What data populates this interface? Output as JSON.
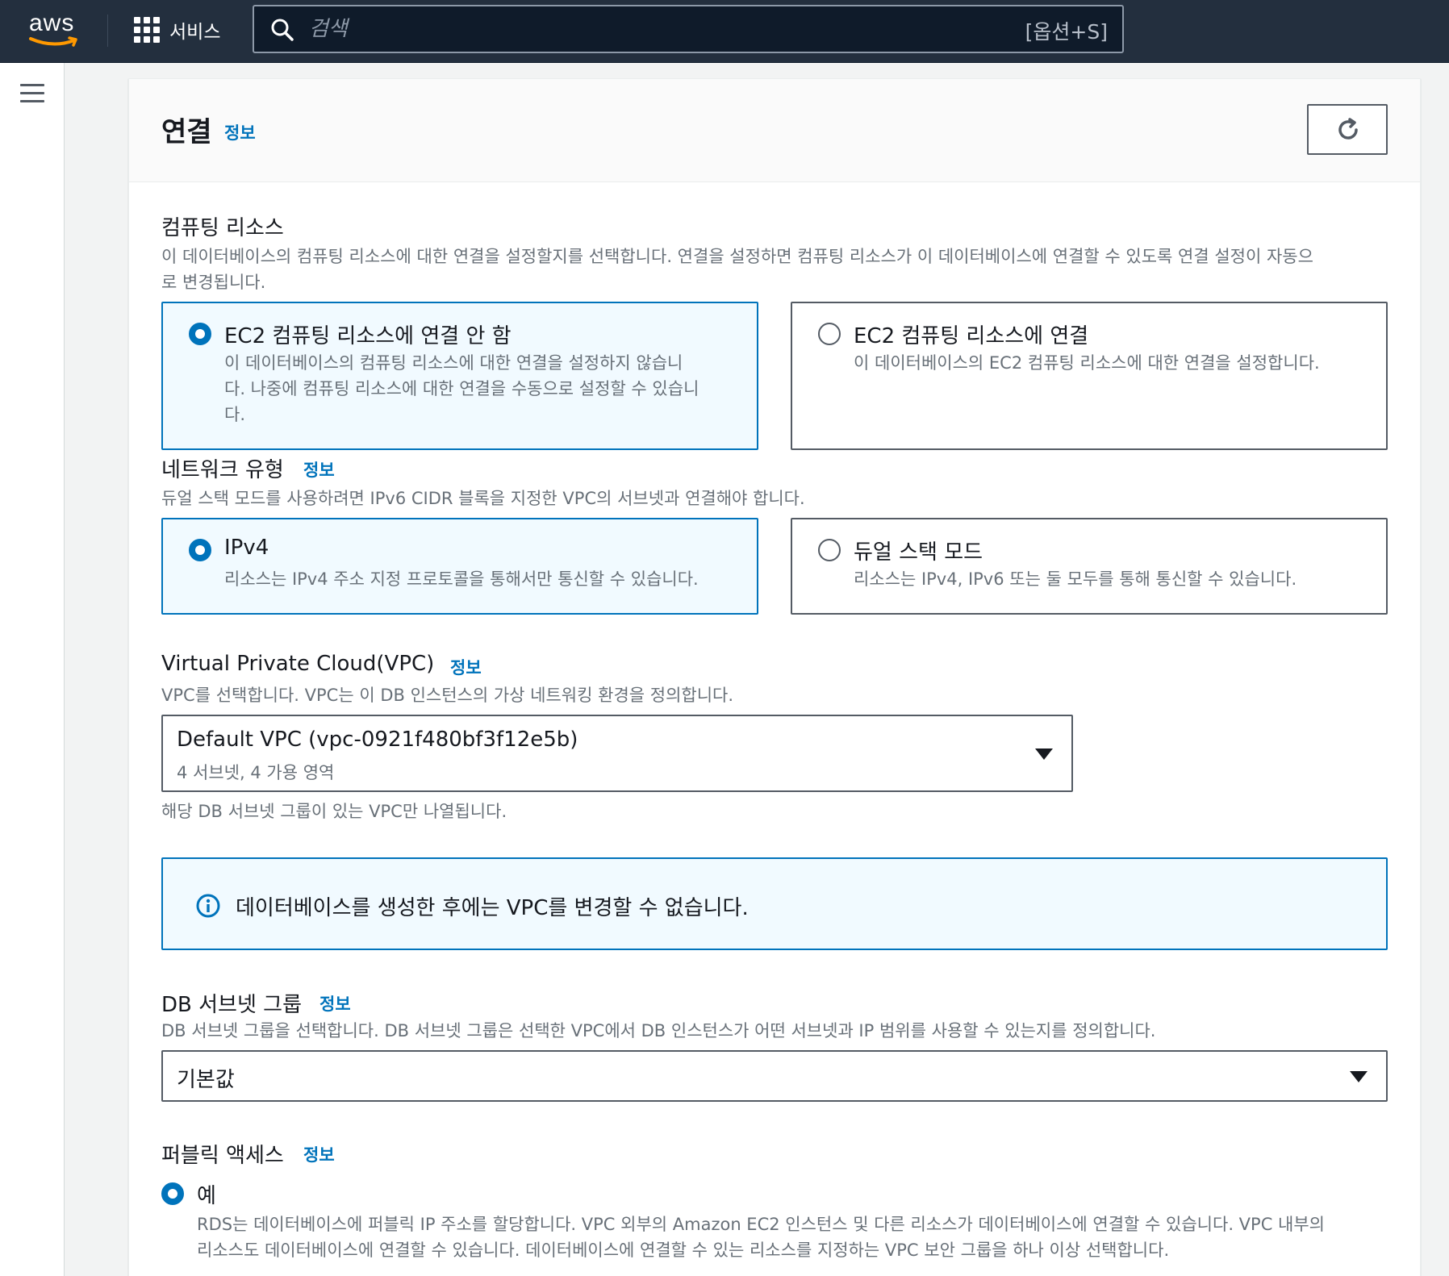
{
  "topnav": {
    "logo_text": "aws",
    "services_label": "서비스",
    "search_placeholder": "검색",
    "search_shortcut": "[옵션+S]"
  },
  "panel": {
    "title": "연결",
    "info": "정보"
  },
  "compute": {
    "label": "컴퓨팅 리소스",
    "desc_line1": "이 데이터베이스의 컴퓨팅 리소스에 대한 연결을 설정할지를 선택합니다. 연결을 설정하면 컴퓨팅 리소스가 이 데이터베이스에 연결할 수 있도록 연결 설정이 자동으",
    "desc_line2": "로 변경됩니다.",
    "options": [
      {
        "title": "EC2 컴퓨팅 리소스에 연결 안 함",
        "desc_lines": [
          "이 데이터베이스의 컴퓨팅 리소스에 대한 연결을 설정하지 않습니",
          "다. 나중에 컴퓨팅 리소스에 대한 연결을 수동으로 설정할 수 있습니",
          "다."
        ],
        "selected": true
      },
      {
        "title": "EC2 컴퓨팅 리소스에 연결",
        "desc_lines": [
          "이 데이터베이스의 EC2 컴퓨팅 리소스에 대한 연결을 설정합니다."
        ],
        "selected": false
      }
    ]
  },
  "network": {
    "label": "네트워크 유형",
    "info": "정보",
    "desc": "듀얼 스택 모드를 사용하려면 IPv6 CIDR 블록을 지정한 VPC의 서브넷과 연결해야 합니다.",
    "options": [
      {
        "title": "IPv4",
        "desc": "리소스는 IPv4 주소 지정 프로토콜을 통해서만 통신할 수 있습니다.",
        "selected": true
      },
      {
        "title": "듀얼 스택 모드",
        "desc": "리소스는 IPv4, IPv6 또는 둘 모두를 통해 통신할 수 있습니다.",
        "selected": false
      }
    ]
  },
  "vpc": {
    "label": "Virtual Private Cloud(VPC)",
    "info": "정보",
    "desc": "VPC를 선택합니다. VPC는 이 DB 인스턴스의 가상 네트워킹 환경을 정의합니다.",
    "selected_value": "Default VPC (vpc-0921f480bf3f12e5b)",
    "selected_sub": "4 서브넷, 4 가용 영역",
    "hint": "해당 DB 서브넷 그룹이 있는 VPC만 나열됩니다."
  },
  "alert": {
    "icon": "info-circle-icon",
    "text": "데이터베이스를 생성한 후에는 VPC를 변경할 수 없습니다."
  },
  "subnet_group": {
    "label": "DB 서브넷 그룹",
    "info": "정보",
    "desc": "DB 서브넷 그룹을 선택합니다. DB 서브넷 그룹은 선택한 VPC에서 DB 인스턴스가 어떤 서브넷과 IP 범위를 사용할 수 있는지를 정의합니다.",
    "selected_value": "기본값"
  },
  "public_access": {
    "label": "퍼블릭 액세스",
    "info": "정보",
    "option_yes": "예",
    "option_yes_selected": true,
    "desc_line1": "RDS는 데이터베이스에 퍼블릭 IP 주소를 할당합니다. VPC 외부의 Amazon EC2 인스턴스 및 다른 리소스가 데이터베이스에 연결할 수 있습니다. VPC 내부의",
    "desc_line2": "리소스도 데이터베이스에 연결할 수 있습니다. 데이터베이스에 연결할 수 있는 리소스를 지정하는 VPC 보안 그룹을 하나 이상 선택합니다."
  },
  "colors": {
    "nav_bg": "#232f3e",
    "accent": "#0073bb",
    "selected_bg": "#f1faff",
    "logo_smile": "#ff9900"
  }
}
